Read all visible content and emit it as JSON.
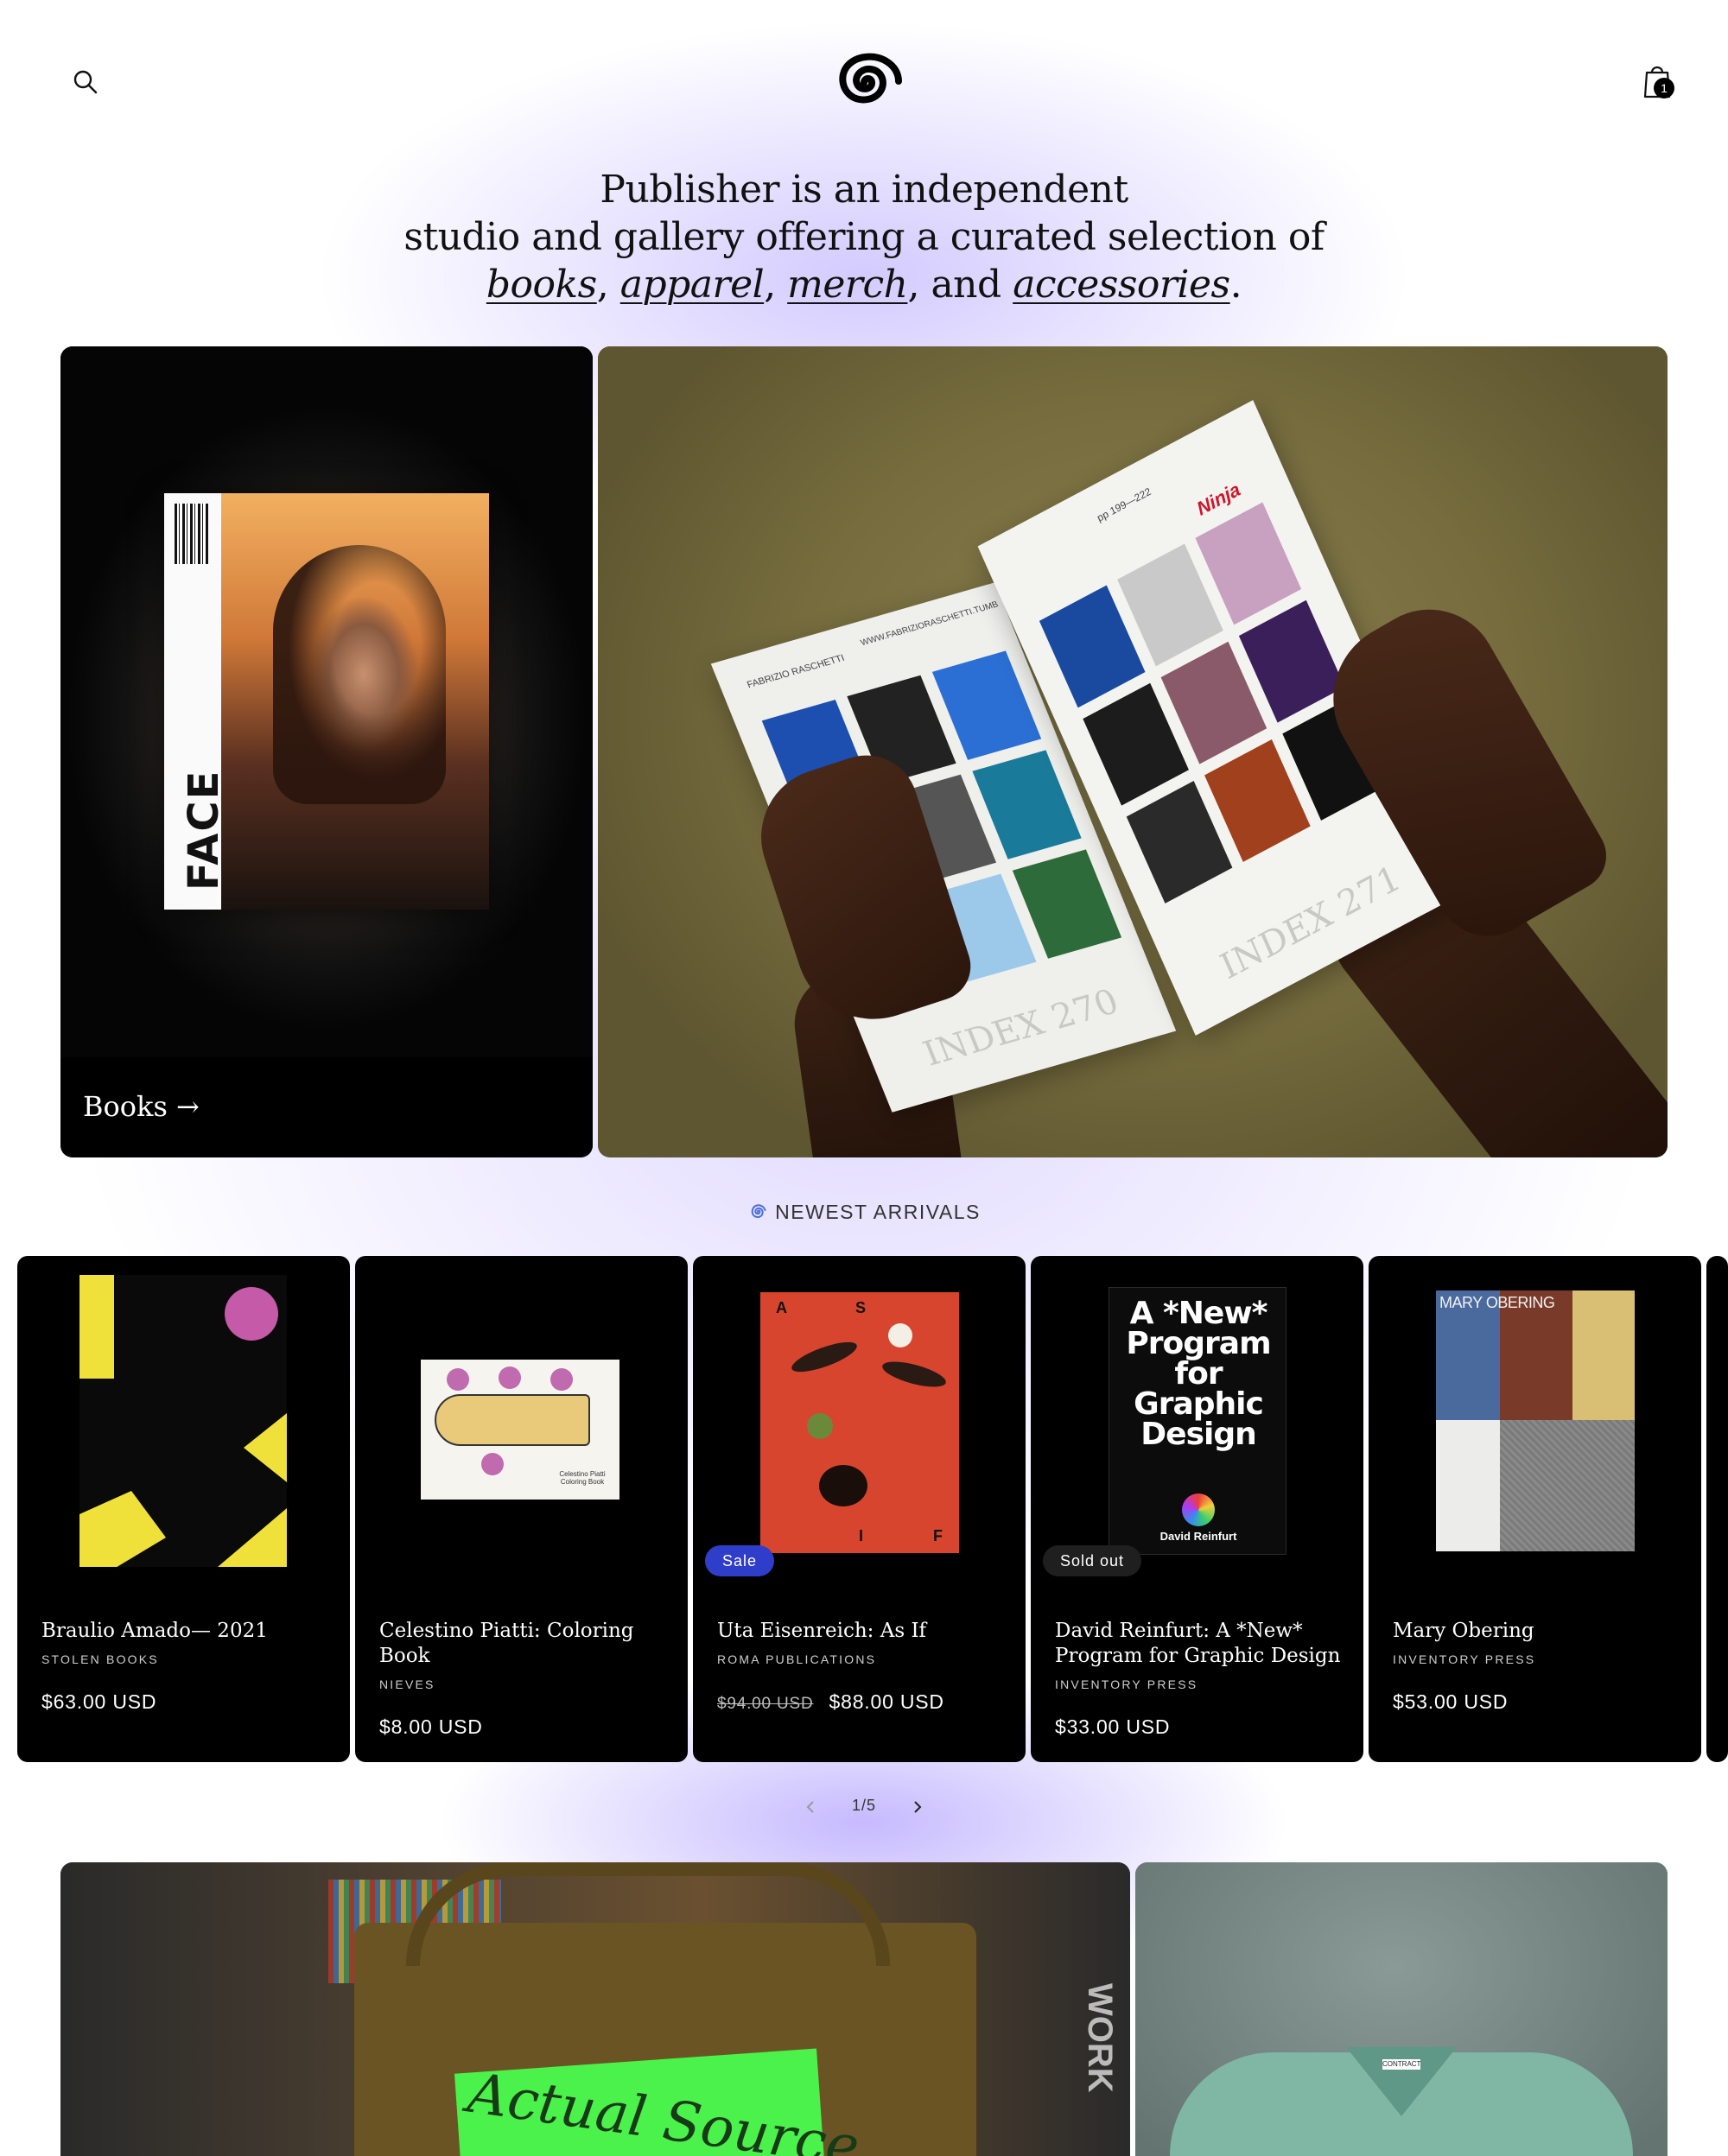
{
  "header": {
    "search_icon": "search-icon",
    "logo_icon": "spiral-logo-icon",
    "cart_icon": "shopping-bag-icon",
    "cart_count": "1"
  },
  "hero": {
    "line1": "Publisher is an independent",
    "line2": "studio and gallery offering a curated selection of",
    "link_books": "books",
    "link_apparel": "apparel",
    "link_merch": "merch",
    "and": "and",
    "link_accessories": "accessories"
  },
  "featured": {
    "books_card": {
      "label": "Books →",
      "magazine_title": "FACE"
    },
    "zine_card": {
      "index_left": "INDEX 270",
      "index_right": "INDEX 271",
      "page_label": "pp 199—222",
      "brand_text": "Ninja",
      "author": "FABRIZIO RASCHETTI",
      "url": "WWW.FABRIZIORASCHETTI.TUMB"
    }
  },
  "newest": {
    "heading": "NEWEST ARRIVALS",
    "products": [
      {
        "title": "Braulio Amado— 2021",
        "vendor": "STOLEN BOOKS",
        "price": "$63.00 USD",
        "old_price": "",
        "badge": ""
      },
      {
        "title": "Celestino Piatti: Coloring Book",
        "vendor": "NIEVES",
        "price": "$8.00 USD",
        "old_price": "",
        "badge": "",
        "cover_text": "Celestino Piatti Coloring Book"
      },
      {
        "title": "Uta Eisenreich: As If",
        "vendor": "ROMA PUBLICATIONS",
        "price": "$88.00 USD",
        "old_price": "$94.00 USD",
        "badge": "Sale",
        "cover_letters": [
          "A",
          "S",
          "I",
          "F"
        ]
      },
      {
        "title": "David Reinfurt: A *New* Program for Graphic Design",
        "vendor": "INVENTORY PRESS",
        "price": "$33.00 USD",
        "old_price": "",
        "badge": "Sold out",
        "cover_title": "A *New* Program for Graphic Design",
        "cover_author": "David Reinfurt"
      },
      {
        "title": "Mary Obering",
        "vendor": "INVENTORY PRESS",
        "price": "$53.00 USD",
        "old_price": "",
        "badge": "",
        "cover_text": "MARY OBERING"
      }
    ],
    "pager": {
      "label": "1/5",
      "prev_icon": "chevron-left-icon",
      "next_icon": "chevron-right-icon"
    }
  },
  "bottom_cards": {
    "tote_text": "Actual Source",
    "tote_side_text": "WORK",
    "shirt_tag": "CONTRACT"
  }
}
